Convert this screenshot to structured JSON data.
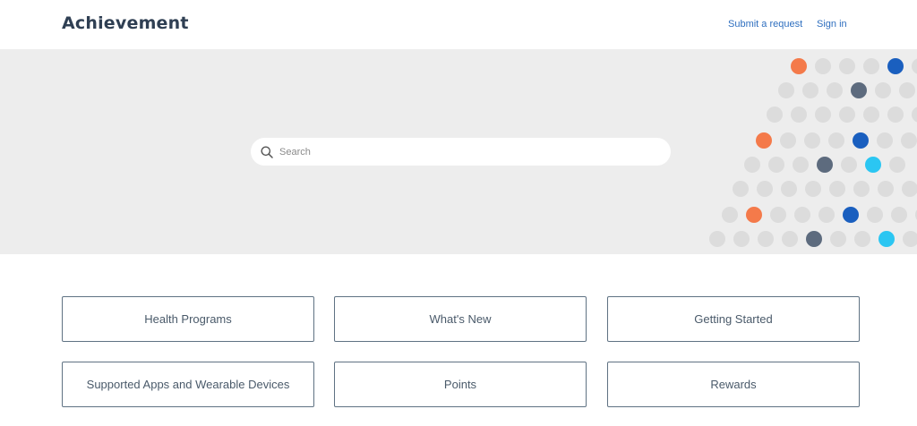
{
  "header": {
    "logo": "Achievement",
    "nav": {
      "submit_request": "Submit a request",
      "sign_in": "Sign in"
    }
  },
  "hero": {
    "search": {
      "placeholder": "Search",
      "value": ""
    },
    "dot_colors": {
      "grey": "#dcdcdc",
      "orange": "#f47a4a",
      "blue": "#1a5fbf",
      "slate": "#5d6b7e",
      "cyan": "#2bc6f2"
    },
    "dot_rows": [
      [
        "orange",
        "grey",
        "grey",
        "grey",
        "blue",
        "grey"
      ],
      [
        "grey",
        "grey",
        "grey",
        "slate",
        "grey",
        "grey"
      ],
      [
        "grey",
        "grey",
        "grey",
        "grey",
        "grey",
        "grey",
        "grey"
      ],
      [
        "orange",
        "grey",
        "grey",
        "grey",
        "blue",
        "grey",
        "grey"
      ],
      [
        "grey",
        "grey",
        "grey",
        "slate",
        "grey",
        "cyan",
        "grey"
      ],
      [
        "grey",
        "grey",
        "grey",
        "grey",
        "grey",
        "grey",
        "grey",
        "grey"
      ],
      [
        "grey",
        "orange",
        "grey",
        "grey",
        "grey",
        "blue",
        "grey",
        "grey",
        "grey"
      ],
      [
        "grey",
        "grey",
        "grey",
        "grey",
        "slate",
        "grey",
        "grey",
        "cyan",
        "grey"
      ]
    ]
  },
  "categories": [
    "Health Programs",
    "What's New",
    "Getting Started",
    "Supported Apps and Wearable Devices",
    "Points",
    "Rewards"
  ]
}
